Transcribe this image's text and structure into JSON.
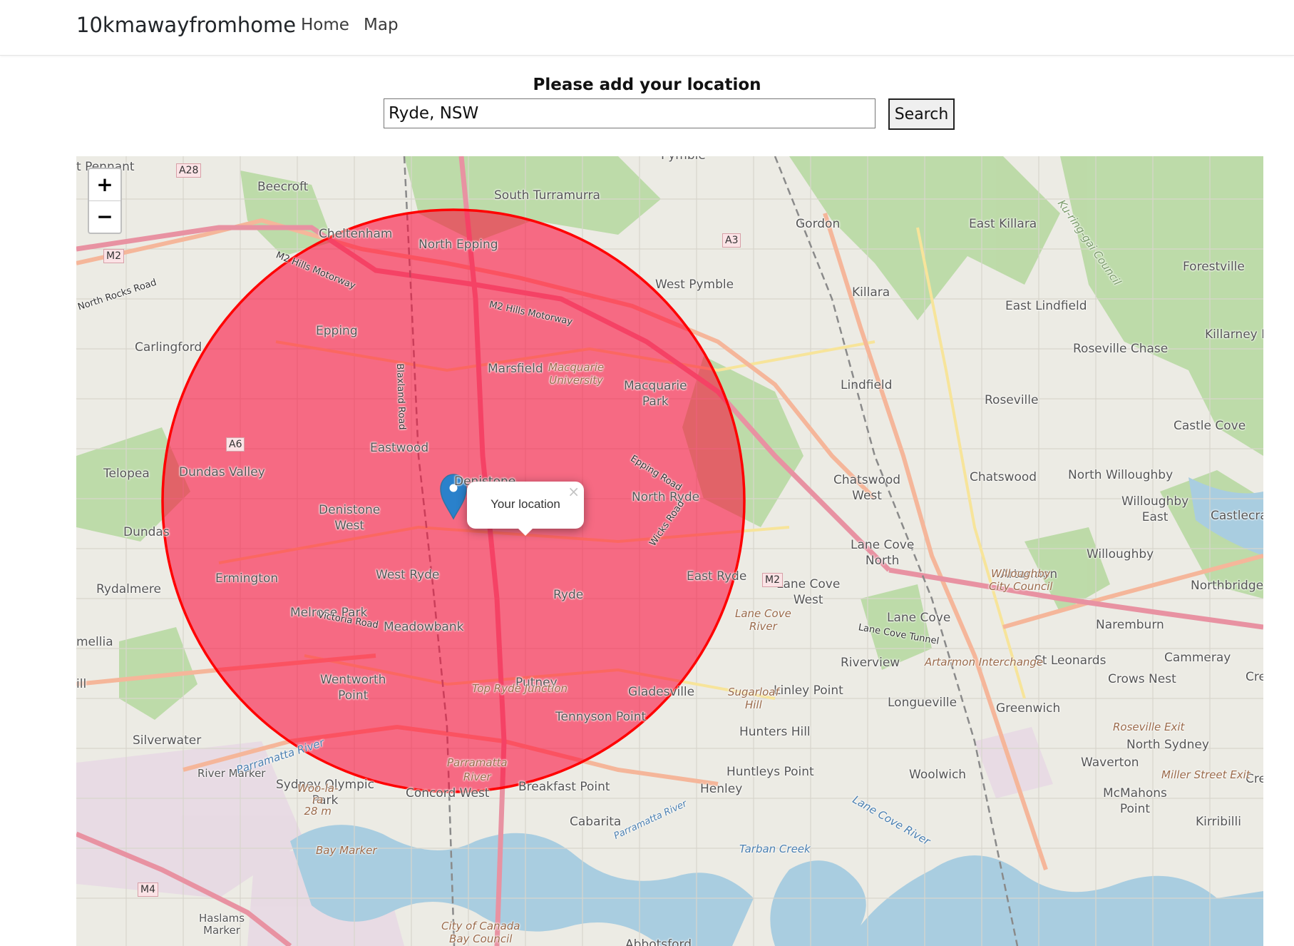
{
  "navbar": {
    "brand": "10kmawayfromhome",
    "links": [
      {
        "label": "Home"
      },
      {
        "label": "Map"
      }
    ]
  },
  "form": {
    "title": "Please add your location",
    "location_value": "Ryde, NSW",
    "search_label": "Search"
  },
  "map": {
    "zoom_in": "+",
    "zoom_out": "−",
    "popup_text": "Your location",
    "popup_close": "×",
    "radius_km": 10,
    "circle_color": "#ff0000",
    "circle_fill": "#f03",
    "marker_icon": "map-pin-icon",
    "labels": [
      {
        "name": "Pymble"
      },
      {
        "name": "t Pennant"
      },
      {
        "name": "Beecroft"
      },
      {
        "name": "South Turramurra"
      },
      {
        "name": "Gordon"
      },
      {
        "name": "East Killara"
      },
      {
        "name": "Cheltenham"
      },
      {
        "name": "North Epping"
      },
      {
        "name": "Forestville"
      },
      {
        "name": "West Pymble"
      },
      {
        "name": "Killara"
      },
      {
        "name": "East Lindfield"
      },
      {
        "name": "Epping"
      },
      {
        "name": "Carlingford"
      },
      {
        "name": "Killarney H"
      },
      {
        "name": "Roseville Chase"
      },
      {
        "name": "Marsfield"
      },
      {
        "name": "Macquarie\nPark"
      },
      {
        "name": "Lindfield"
      },
      {
        "name": "Roseville"
      },
      {
        "name": "Castle Cove"
      },
      {
        "name": "Eastwood"
      },
      {
        "name": "Telopea"
      },
      {
        "name": "Dundas Valley"
      },
      {
        "name": "Denistone\nEast"
      },
      {
        "name": "Chatswood\nWest"
      },
      {
        "name": "Chatswood"
      },
      {
        "name": "North Willoughby"
      },
      {
        "name": "North Ryde"
      },
      {
        "name": "Denistone\nWest"
      },
      {
        "name": "Willoughby\nEast"
      },
      {
        "name": "Castlecra"
      },
      {
        "name": "Dundas"
      },
      {
        "name": "Lane Cove\nNorth"
      },
      {
        "name": "Willoughby"
      },
      {
        "name": "Ermington"
      },
      {
        "name": "West Ryde"
      },
      {
        "name": "East Ryde"
      },
      {
        "name": "Artarmon"
      },
      {
        "name": "Rydalmere"
      },
      {
        "name": "Lane Cove\nWest"
      },
      {
        "name": "Northbridge"
      },
      {
        "name": "Ryde"
      },
      {
        "name": "Melrose Park"
      },
      {
        "name": "Lane Cove"
      },
      {
        "name": "Naremburn"
      },
      {
        "name": "Meadowbank"
      },
      {
        "name": "mellia"
      },
      {
        "name": "Cammeray"
      },
      {
        "name": "St Leonards"
      },
      {
        "name": "Riverview"
      },
      {
        "name": "Crows Nest"
      },
      {
        "name": "Cre"
      },
      {
        "name": "Wentworth\nPoint"
      },
      {
        "name": "Putney"
      },
      {
        "name": "Linley Point"
      },
      {
        "name": "Gladesville"
      },
      {
        "name": "Longueville"
      },
      {
        "name": "Greenwich"
      },
      {
        "name": "Tennyson Point"
      },
      {
        "name": "ill"
      },
      {
        "name": "Silverwater"
      },
      {
        "name": "Hunters Hill"
      },
      {
        "name": "North Sydney"
      },
      {
        "name": "Waverton"
      },
      {
        "name": "Huntleys Point"
      },
      {
        "name": "Woolwich"
      },
      {
        "name": "Sydney Olympic\nPark"
      },
      {
        "name": "Henley"
      },
      {
        "name": "Cre"
      },
      {
        "name": "Breakfast Point"
      },
      {
        "name": "McMahons\nPoint"
      },
      {
        "name": "Concord West"
      },
      {
        "name": "Cabarita"
      },
      {
        "name": "Kirribilli"
      },
      {
        "name": "Abbotsford"
      }
    ],
    "feature_labels": [
      {
        "name": "Macquarie\nUniversity"
      },
      {
        "name": "Willoughby\nCity Council"
      },
      {
        "name": "Lane Cove\nRiver"
      },
      {
        "name": "Artarmon Interchange"
      },
      {
        "name": "Top Ryde Junction"
      },
      {
        "name": "Sugarloaf\nHill"
      },
      {
        "name": "Roseville Exit"
      },
      {
        "name": "Miller Street Exit"
      },
      {
        "name": "Parramatta\nRiver"
      },
      {
        "name": "River Marker"
      },
      {
        "name": "Woo-la-\nra\n28 m"
      },
      {
        "name": "Bay Marker"
      },
      {
        "name": "Haslams\nMarker"
      },
      {
        "name": "City of Canada\nBay Council"
      },
      {
        "name": "Parramatta River"
      },
      {
        "name": "Lane Cove River"
      },
      {
        "name": "Tarban Creek"
      },
      {
        "name": "Ku-ring-gai Council"
      }
    ],
    "road_labels": [
      {
        "name": "M2 Hills Motorway"
      },
      {
        "name": "M2 Hills Motorway"
      },
      {
        "name": "Epping Road"
      },
      {
        "name": "Wicks Road"
      },
      {
        "name": "Victoria Road"
      },
      {
        "name": "Lane Cove Tunnel"
      },
      {
        "name": "North Rocks Road"
      },
      {
        "name": "Blaxland Road"
      },
      {
        "name": "Parramatta River"
      }
    ],
    "shields": [
      {
        "name": "A28"
      },
      {
        "name": "M2"
      },
      {
        "name": "A3"
      },
      {
        "name": "A6"
      },
      {
        "name": "M2"
      },
      {
        "name": "M4"
      }
    ]
  }
}
